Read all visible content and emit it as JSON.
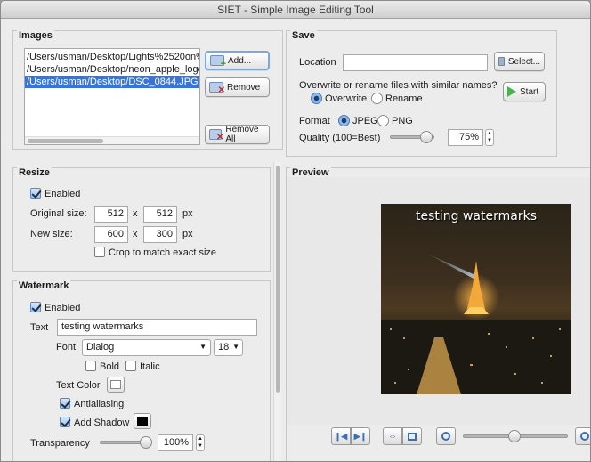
{
  "window": {
    "title": "SIET - Simple Image Editing Tool"
  },
  "images": {
    "title": "Images",
    "files": [
      "/Users/usman/Desktop/Lights%2520on%2520",
      "/Users/usman/Desktop/neon_apple_logo.jpg",
      "/Users/usman/Desktop/DSC_0844.JPG"
    ],
    "selected_index": 2,
    "add_label": "Add...",
    "remove_label": "Remove",
    "remove_all_label": "Remove All"
  },
  "save": {
    "title": "Save",
    "location_label": "Location",
    "location_value": "",
    "select_label": "Select...",
    "overwrite_question": "Overwrite or rename files with similar names?",
    "overwrite_label": "Overwrite",
    "rename_label": "Rename",
    "overwrite_selected": "Overwrite",
    "start_label": "Start",
    "format_label": "Format",
    "jpeg_label": "JPEG",
    "png_label": "PNG",
    "format_selected": "JPEG",
    "quality_label": "Quality (100=Best)",
    "quality_value": "75%",
    "quality_fraction": 0.75
  },
  "resize": {
    "title": "Resize",
    "enabled_label": "Enabled",
    "enabled": true,
    "original_label": "Original size:",
    "original_w": "512",
    "original_h": "512",
    "new_label": "New size:",
    "new_w": "600",
    "new_h": "300",
    "times": "x",
    "unit": "px",
    "crop_label": "Crop to match exact size",
    "crop": false
  },
  "watermark": {
    "title": "Watermark",
    "enabled_label": "Enabled",
    "enabled": true,
    "text_label": "Text",
    "text_value": "testing watermarks",
    "font_label": "Font",
    "font_value": "Dialog",
    "size_value": "18",
    "bold_label": "Bold",
    "italic_label": "Italic",
    "text_color_label": "Text Color",
    "antialiasing_label": "Antialiasing",
    "add_shadow_label": "Add Shadow",
    "transparency_label": "Transparency",
    "transparency_value": "100%",
    "transparency_fraction": 1.0
  },
  "preview": {
    "title": "Preview",
    "watermark_text": "testing watermarks"
  },
  "colors": {
    "selection": "#3875d7",
    "panel_bg": "#ececec"
  }
}
